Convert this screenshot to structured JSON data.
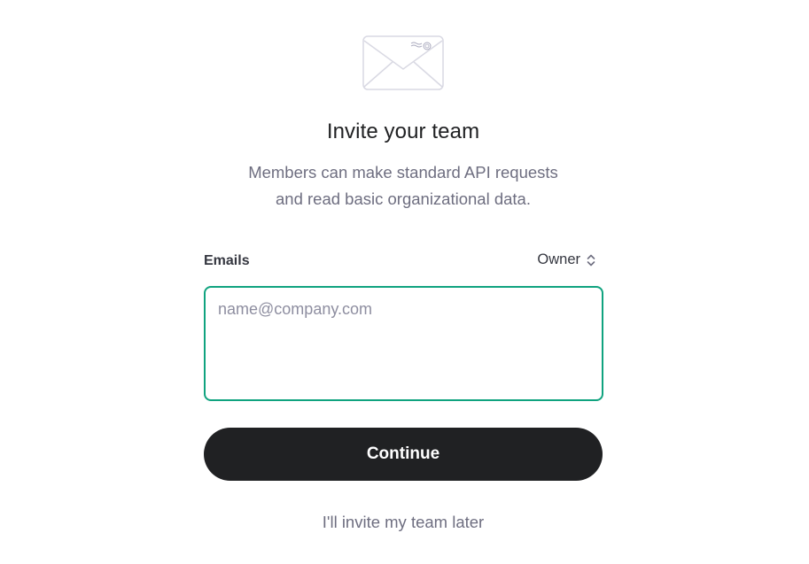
{
  "header": {
    "icon": "envelope-icon",
    "title": "Invite your team",
    "subtitle_lines": [
      "Members can make standard API requests",
      "and read basic organizational data."
    ]
  },
  "form": {
    "emails_label": "Emails",
    "role_selected": "Owner",
    "emails_placeholder": "name@company.com",
    "emails_value": ""
  },
  "actions": {
    "continue_label": "Continue",
    "later_label": "I'll invite my team later"
  },
  "colors": {
    "accent": "#10a37f",
    "button_bg": "#202123",
    "muted_text": "#6e6e80"
  }
}
